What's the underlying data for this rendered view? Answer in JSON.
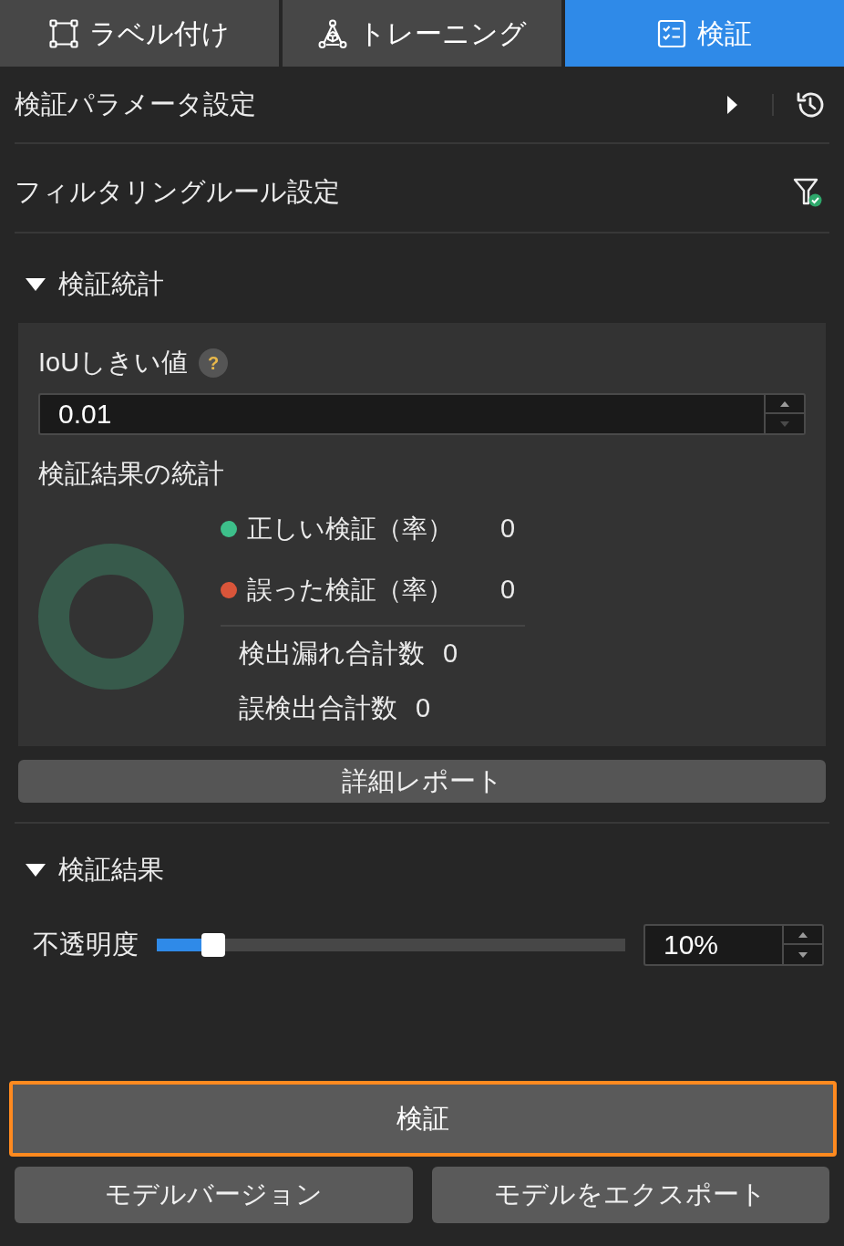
{
  "tabs": [
    {
      "label": "ラベル付け",
      "selected": false
    },
    {
      "label": "トレーニング",
      "selected": false
    },
    {
      "label": "検証",
      "selected": true
    }
  ],
  "settings_rows": [
    {
      "label": "検証パラメータ設定",
      "kind": "run"
    },
    {
      "label": "フィルタリングルール設定",
      "kind": "filter"
    }
  ],
  "stats_section": {
    "title": "検証統計",
    "expanded": true,
    "iou": {
      "label": "IoUしきい値",
      "help": "?",
      "value": "0.01",
      "decrement_disabled": true
    },
    "stats_title": "検証結果の統計",
    "legend": [
      {
        "label": "正しい検証（率）",
        "value": "0",
        "color": "#3dbf8a"
      },
      {
        "label": "誤った検証（率）",
        "value": "0",
        "color": "#d9553a"
      }
    ],
    "totals": [
      {
        "label": "検出漏れ合計数",
        "value": "0"
      },
      {
        "label": "誤検出合計数",
        "value": "0"
      }
    ],
    "report_button": "詳細レポート"
  },
  "results_section": {
    "title": "検証結果",
    "expanded": true,
    "opacity": {
      "label": "不透明度",
      "level": 0.1,
      "value": "10%",
      "decrement_disabled": false
    }
  },
  "actions": {
    "verify": {
      "label": "検証",
      "highlighted": true
    },
    "buttons": [
      "モデルバージョン",
      "モデルをエクスポート"
    ]
  }
}
